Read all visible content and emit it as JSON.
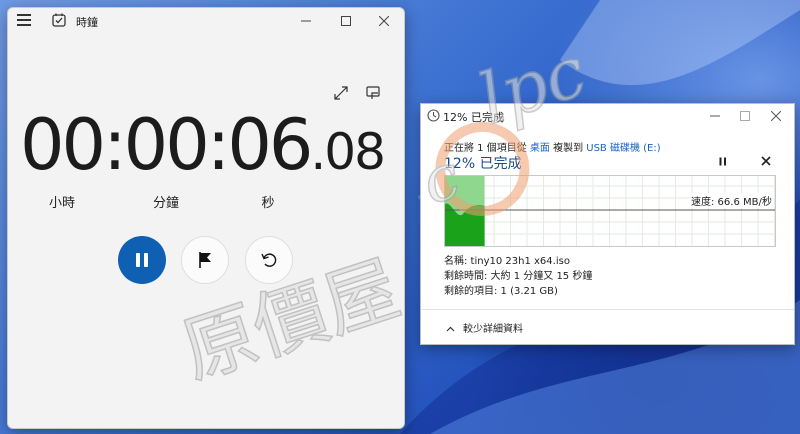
{
  "clock_app": {
    "title": "時鐘",
    "stopwatch": {
      "main": "00:00:06",
      "fraction": ".08"
    },
    "labels": {
      "hours": "小時",
      "minutes": "分鐘",
      "seconds": "秒"
    }
  },
  "copy_dialog": {
    "title": "12% 已完成",
    "line1": {
      "prefix": "正在將 1 個項目從 ",
      "source": "桌面",
      "middle": " 複製到 ",
      "destination": "USB 磁碟機 (E:)"
    },
    "heading": "12% 已完成",
    "progress_percent": 12,
    "speed": "速度: 66.6 MB/秒",
    "name_line": "名稱:  tiny10 23h1 x64.iso",
    "time_line": "剩餘時間:  大約 1 分鐘又 15 秒鐘",
    "items_line": "剩餘的項目:  1 (3.21 GB)",
    "less_details": "較少詳細資料"
  },
  "colors": {
    "accent": "#0f5fb3",
    "graph_fill": "#1aa31a",
    "graph_fill_light": "#8fd68f",
    "link": "#1a62c7"
  },
  "watermark": {
    "text": "原價屋"
  }
}
